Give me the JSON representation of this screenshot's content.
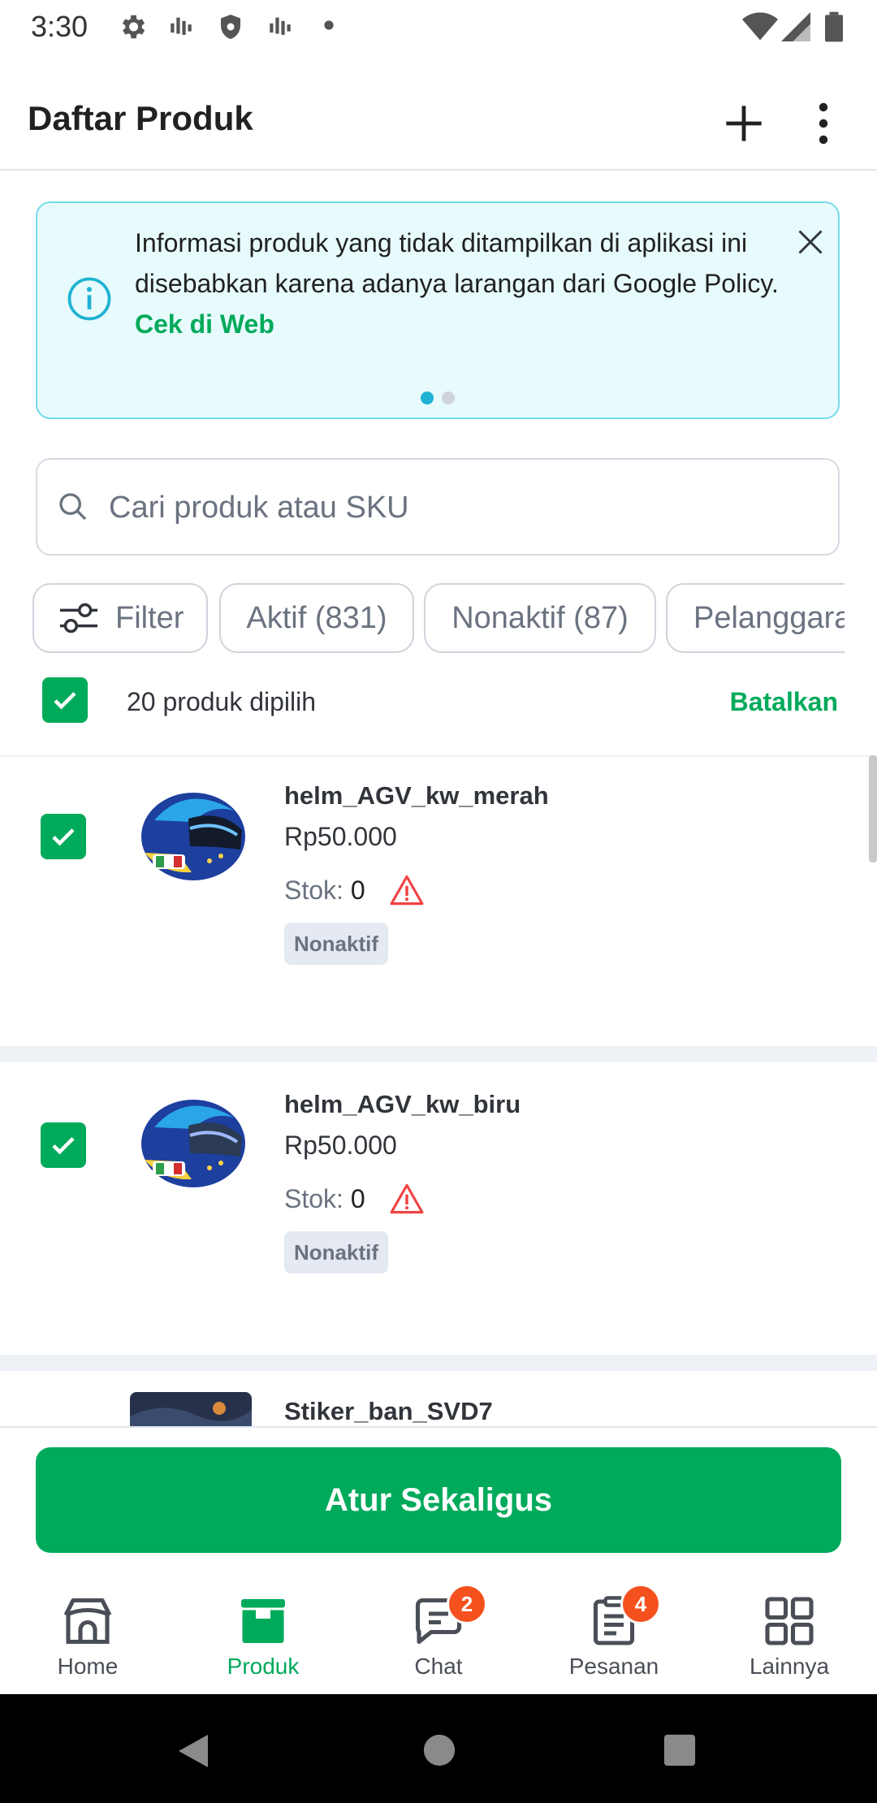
{
  "status_bar": {
    "time": "3:30"
  },
  "app_bar": {
    "title": "Daftar Produk"
  },
  "banner": {
    "text": "Informasi produk yang tidak ditampilkan di aplikasi ini disebabkan karena adanya larangan dari Google Policy.",
    "link": "Cek di Web",
    "page_count": 2,
    "active_page": 1
  },
  "search": {
    "placeholder": "Cari produk atau SKU",
    "value": ""
  },
  "filter_chips": [
    {
      "label": "Filter",
      "icon": "sliders-icon"
    },
    {
      "label": "Aktif (831)"
    },
    {
      "label": "Nonaktif (87)"
    },
    {
      "label": "Pelanggara"
    }
  ],
  "selection": {
    "count_text": "20 produk dipilih",
    "cancel_label": "Batalkan",
    "all_checked": true
  },
  "products": [
    {
      "name": "helm_AGV_kw_merah",
      "price": "Rp50.000",
      "stock_label": "Stok:",
      "stock": "0",
      "status": "Nonaktif",
      "checked": true
    },
    {
      "name": "helm_AGV_kw_biru",
      "price": "Rp50.000",
      "stock_label": "Stok:",
      "stock": "0",
      "status": "Nonaktif",
      "checked": true
    },
    {
      "name": "Stiker_ban_SVD7"
    }
  ],
  "action": {
    "label": "Atur Sekaligus"
  },
  "bottom_nav": [
    {
      "label": "Home",
      "icon": "store-icon"
    },
    {
      "label": "Produk",
      "icon": "product-box-icon",
      "active": true
    },
    {
      "label": "Chat",
      "icon": "chat-icon",
      "badge": "2"
    },
    {
      "label": "Pesanan",
      "icon": "orders-icon",
      "badge": "4"
    },
    {
      "label": "Lainnya",
      "icon": "grid-icon"
    }
  ],
  "colors": {
    "primary": "#00aa5b",
    "banner_bg": "#e7fafc",
    "banner_border": "#73dbe9",
    "info": "#1fb2d3",
    "warning": "#ef4444",
    "badge": "#f4511e"
  }
}
